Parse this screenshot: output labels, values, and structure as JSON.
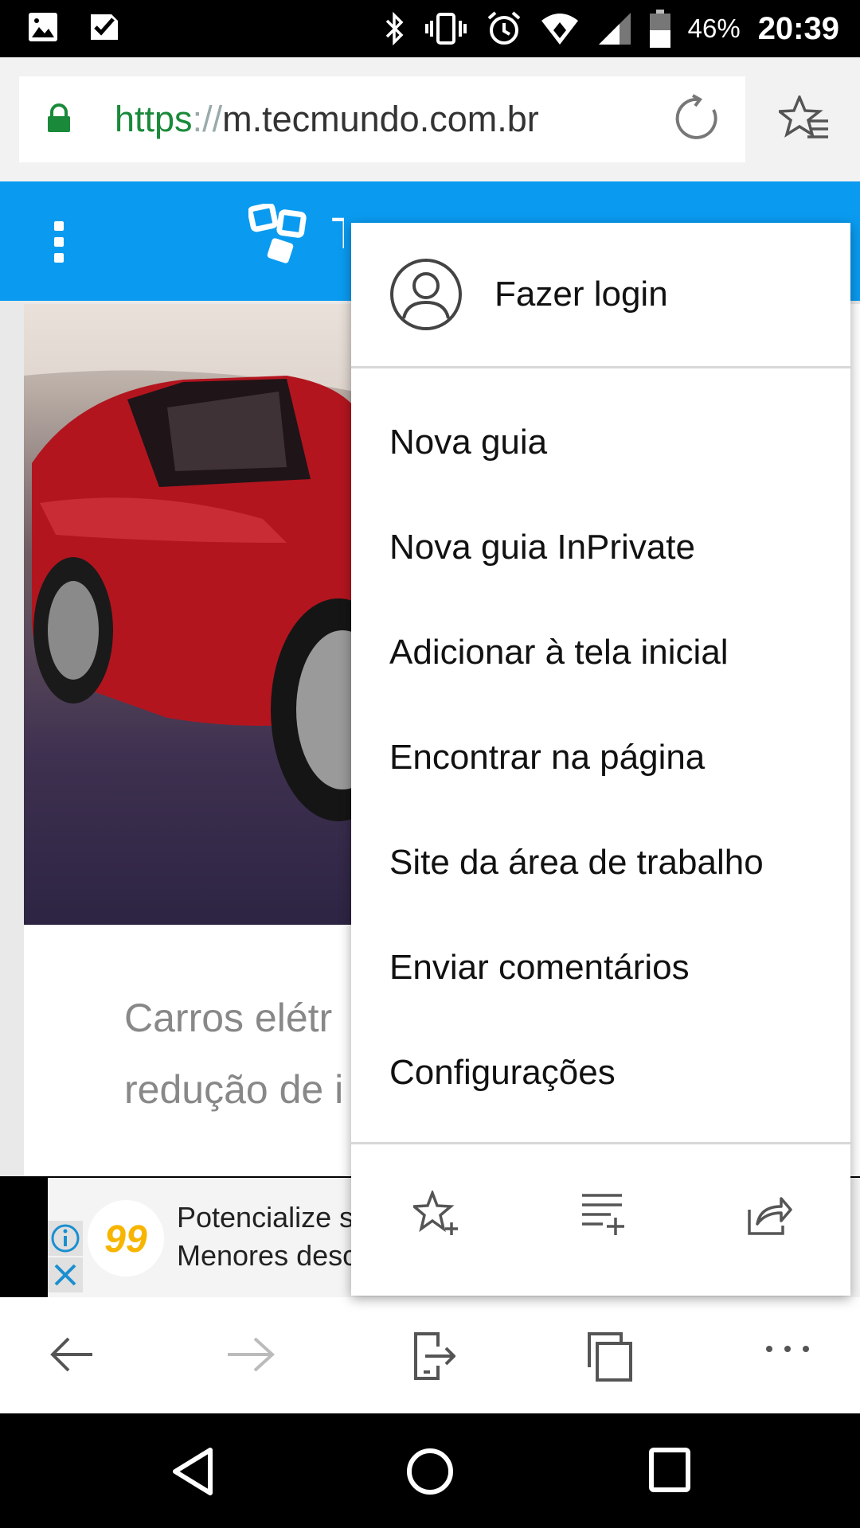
{
  "status_bar": {
    "battery": "46%",
    "time": "20:39",
    "left_icons": [
      "image-icon",
      "checkmark-icon"
    ],
    "right_icons": [
      "bluetooth-icon",
      "vibrate-icon",
      "alarm-icon",
      "wifi-icon",
      "signal-icon",
      "battery-icon"
    ]
  },
  "address_bar": {
    "scheme": "https",
    "separator": "://",
    "host": "m.tecmundo.com.br"
  },
  "site_header": {
    "logo_letter": "T"
  },
  "article": {
    "headline_line1": "Carros elétr",
    "headline_line2": "redução de i"
  },
  "ad": {
    "logo_text": "99",
    "line1": "Potencialize s",
    "line2": "Menores desc"
  },
  "menu": {
    "login": "Fazer login",
    "items": [
      "Nova guia",
      "Nova guia InPrivate",
      "Adicionar à tela inicial",
      "Encontrar na página",
      "Site da área de trabalho",
      "Enviar comentários",
      "Configurações"
    ],
    "actions": [
      "star-add-icon",
      "reading-list-add-icon",
      "share-icon"
    ]
  },
  "bottom_toolbar": {
    "icons": [
      "back-arrow-icon",
      "forward-arrow-icon",
      "continue-on-pc-icon",
      "tabs-icon",
      "more-icon"
    ]
  },
  "colors": {
    "header_blue": "#0a9bf0",
    "secure_green": "#1a8a3a",
    "ad_yellow": "#f7b500"
  }
}
